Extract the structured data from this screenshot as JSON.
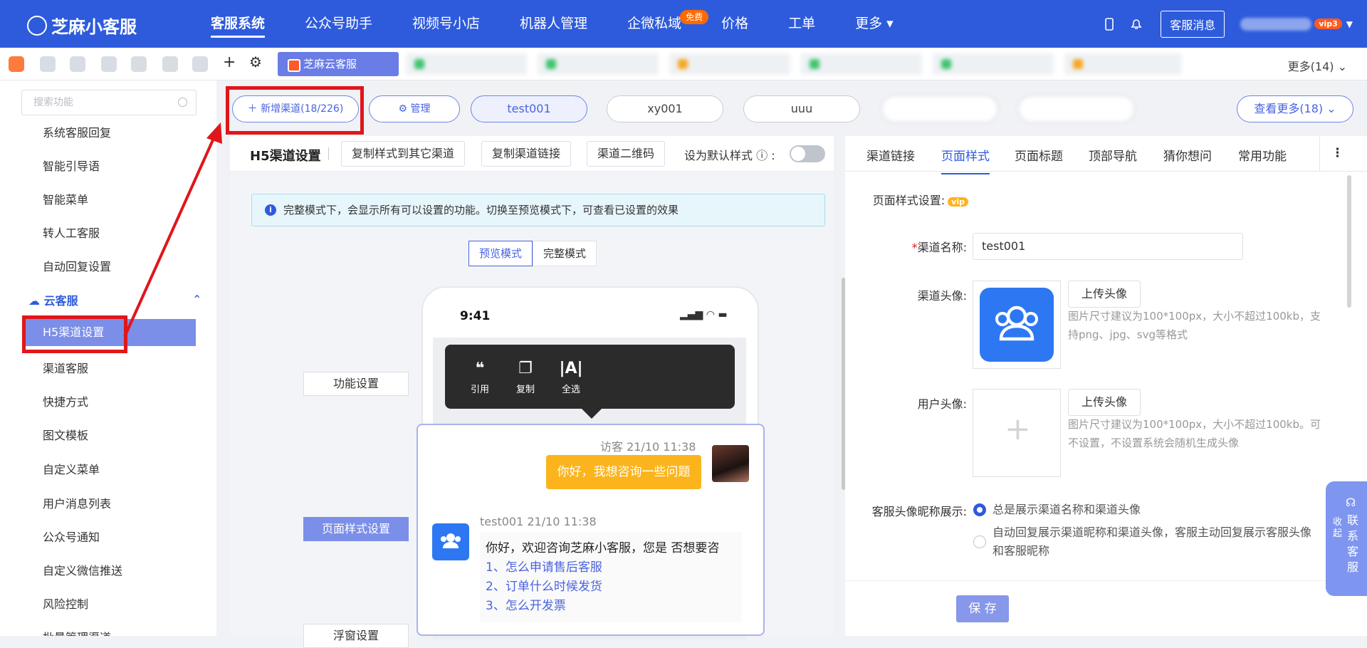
{
  "brand": "芝麻小客服",
  "nav": {
    "items": [
      "客服系统",
      "公众号助手",
      "视频号小店",
      "机器人管理",
      "企微私域",
      "价格",
      "工单",
      "更多"
    ],
    "free_badge": "免费",
    "msg_button": "客服消息",
    "vip_badge": "vip3"
  },
  "tabs": {
    "active": "芝麻云客服",
    "more": "更多(14)"
  },
  "sidebar": {
    "search_placeholder": "搜索功能",
    "items_top": [
      "系统客服回复",
      "智能引导语",
      "智能菜单",
      "转人工客服",
      "自动回复设置"
    ],
    "group": "云客服",
    "active": "H5渠道设置",
    "items_bottom": [
      "渠道客服",
      "快捷方式",
      "图文模板",
      "自定义菜单",
      "用户消息列表",
      "公众号通知",
      "自定义微信推送",
      "风险控制",
      "批量管理渠道"
    ]
  },
  "channels": {
    "add": "新增渠道(18/226)",
    "manage": "管理",
    "chips": [
      "test001",
      "xy001",
      "uuu"
    ],
    "see_more": "查看更多(18)"
  },
  "left": {
    "title": "H5渠道设置",
    "copy_style": "复制样式到其它渠道",
    "copy_link": "复制渠道链接",
    "qrcode": "渠道二维码",
    "default_style": "设为默认样式",
    "info": "完整模式下，会显示所有可以设置的功能。切换至预览模式下，可查看已设置的效果",
    "mode_preview": "预览模式",
    "mode_full": "完整模式",
    "label_func": "功能设置",
    "label_page": "页面样式设置",
    "label_float": "浮窗设置"
  },
  "phone": {
    "time": "9:41",
    "menu": [
      "引用",
      "复制",
      "全选"
    ],
    "visitor_meta": "访客 21/10 11:38",
    "visitor_msg": "你好，我想咨询一些问题",
    "cs_meta": "test001 21/10 11:38",
    "cs_msg": "你好，欢迎咨询芝麻小客服，您是 否想要咨",
    "questions": [
      "1、怎么申请售后客服",
      "2、订单什么时候发货",
      "3、怎么开发票"
    ]
  },
  "right": {
    "tabs": [
      "渠道链接",
      "页面样式",
      "页面标题",
      "顶部导航",
      "猜你想问",
      "常用功能"
    ],
    "style_label": "页面样式设置:",
    "name_label": "渠道名称:",
    "name_value": "test001",
    "avatar_label": "渠道头像:",
    "upload": "上传头像",
    "avatar_hint": "图片尺寸建议为100*100px，大小不超过100kb，支持png、jpg、svg等格式",
    "user_avatar_label": "用户头像:",
    "user_avatar_hint": "图片尺寸建议为100*100px，大小不超过100kb。可不设置，不设置系统会随机生成头像",
    "display_label": "客服头像昵称展示:",
    "opt1": "总是展示渠道名称和渠道头像",
    "opt2": "自动回复展示渠道昵称和渠道头像，客服主动回复展示客服头像和客服昵称",
    "save": "保 存"
  },
  "float": {
    "collapse": "收起",
    "contact": "联系客服"
  },
  "colors": {
    "primary": "#2e5bdc",
    "accent": "#7b8ee8",
    "highlight": "#e0161b",
    "bubble": "#fbb41c"
  }
}
